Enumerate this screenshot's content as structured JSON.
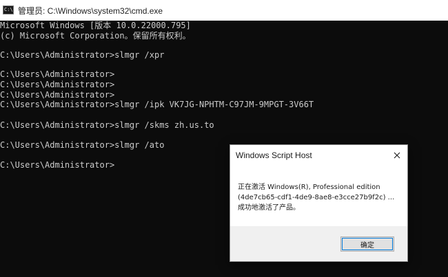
{
  "window": {
    "title": "管理员: C:\\Windows\\system32\\cmd.exe",
    "icon": "cmd-icon",
    "icon_text": "C:\\"
  },
  "console": {
    "lines": [
      "Microsoft Windows [版本 10.0.22000.795]",
      "(c) Microsoft Corporation。保留所有权利。",
      "",
      "C:\\Users\\Administrator>slmgr /xpr",
      "",
      "C:\\Users\\Administrator>",
      "C:\\Users\\Administrator>",
      "C:\\Users\\Administrator>",
      "C:\\Users\\Administrator>slmgr /ipk VK7JG-NPHTM-C97JM-9MPGT-3V66T",
      "",
      "C:\\Users\\Administrator>slmgr /skms zh.us.to",
      "",
      "C:\\Users\\Administrator>slmgr /ato",
      "",
      "C:\\Users\\Administrator>"
    ]
  },
  "dialog": {
    "title": "Windows Script Host",
    "close_icon": "close-icon",
    "message_lines": [
      "正在激活 Windows(R), Professional edition",
      "(4de7cb65-cdf1-4de9-8ae8-e3cce27b9f2c) ...",
      "成功地激活了产品。"
    ],
    "ok_label": "确定"
  },
  "colors": {
    "console_bg": "#0c0c0c",
    "console_text": "#cccccc",
    "focus": "#0078d7"
  }
}
